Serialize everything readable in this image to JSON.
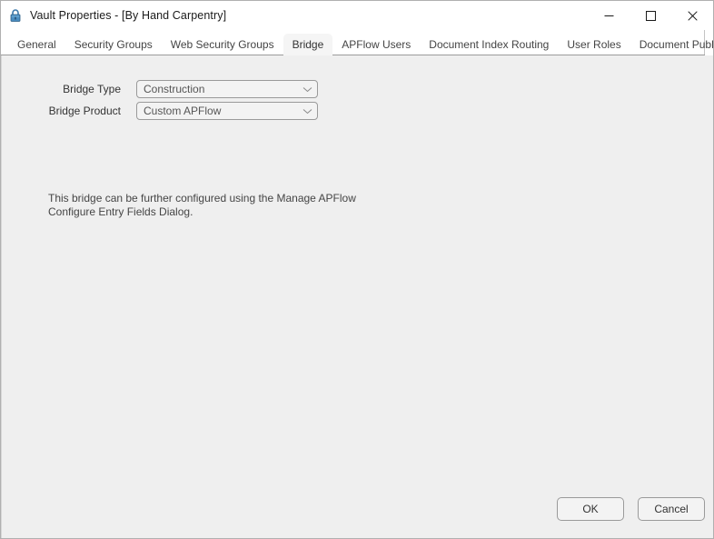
{
  "window": {
    "title": "Vault Properties - [By Hand Carpentry]",
    "icon": "lock-icon",
    "controls": {
      "minimize": "Minimize",
      "maximize": "Maximize",
      "close": "Close"
    },
    "accent_color": "#2b6ca3",
    "background_color": "#efefef",
    "titlebar_color": "#ffffff"
  },
  "tabs": [
    {
      "label": "General",
      "selected": false
    },
    {
      "label": "Security Groups",
      "selected": false
    },
    {
      "label": "Web Security Groups",
      "selected": false
    },
    {
      "label": "Bridge",
      "selected": true
    },
    {
      "label": "APFlow Users",
      "selected": false
    },
    {
      "label": "Document Index Routing",
      "selected": false
    },
    {
      "label": "User Roles",
      "selected": false
    },
    {
      "label": "Document Publishing",
      "selected": false
    }
  ],
  "form": {
    "bridge_type": {
      "label": "Bridge Type",
      "value": "Construction",
      "arrow_icon": "chevron-down-icon"
    },
    "bridge_product": {
      "label": "Bridge Product",
      "value": "Custom APFlow",
      "arrow_icon": "chevron-down-icon"
    }
  },
  "info": {
    "text": "This bridge can be further configured using the Manage APFlow Configure Entry Fields Dialog."
  },
  "footer": {
    "ok_label": "OK",
    "cancel_label": "Cancel"
  }
}
